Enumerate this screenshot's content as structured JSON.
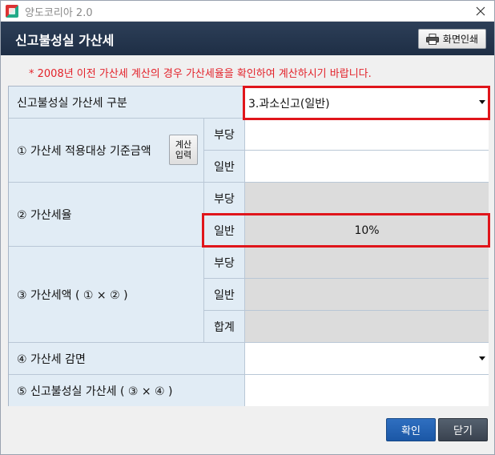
{
  "window": {
    "title": "양도코리아 2.0"
  },
  "header": {
    "title": "신고불성실 가산세",
    "print_label": "화면인쇄"
  },
  "notice": "* 2008년 이전 가산세 계산의 경우 가산세율을 확인하여 계산하시기 바랍니다.",
  "form": {
    "category": {
      "label": "신고불성실 가산세 구분",
      "value": "3.과소신고(일반)"
    },
    "base_amount": {
      "label": "① 가산세 적용대상 기준금액",
      "calc_line1": "계산",
      "calc_line2": "입력",
      "unfair_label": "부당",
      "normal_label": "일반",
      "unfair_value": "",
      "normal_value": ""
    },
    "rate": {
      "label": "② 가산세율",
      "unfair_label": "부당",
      "normal_label": "일반",
      "unfair_value": "",
      "normal_value": "10%"
    },
    "amount": {
      "label": "③ 가산세액 ( ① × ② )",
      "unfair_label": "부당",
      "normal_label": "일반",
      "total_label": "합계",
      "unfair_value": "",
      "normal_value": "",
      "total_value": ""
    },
    "reduction": {
      "label": "④ 가산세 감면",
      "value": ""
    },
    "final": {
      "label": "⑤ 신고불성실 가산세 ( ③ × ④ )",
      "value": ""
    }
  },
  "buttons": {
    "ok": "확인",
    "close": "닫기"
  },
  "colors": {
    "header_bg": "#22324a",
    "label_bg": "#e1ecf5",
    "readonly_bg": "#dcdcdc",
    "highlight": "#e0151b",
    "notice": "#e3222a",
    "ok_btn": "#1f5fb0",
    "close_btn": "#444e5b"
  }
}
